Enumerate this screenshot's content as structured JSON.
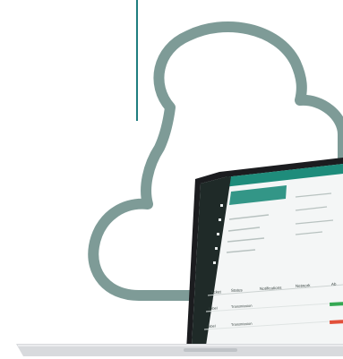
{
  "colors": {
    "background": "#ffffff",
    "cloud_outline": "#7e9b97",
    "accent_line": "#1f7d7f",
    "laptop_bezel": "#1b1c1f",
    "laptop_base": "#d8dadd",
    "app_header": "#1e8c7b",
    "app_sidebar": "#1f2a28",
    "status_green": "#34a853",
    "status_red": "#e2503a"
  },
  "laptop_app": {
    "toolbar": [
      "Ticket",
      "Status",
      "Notifications",
      "Network",
      "Ab"
    ],
    "rows": [
      {
        "col1": "Label",
        "col2": "Transmission",
        "col3": "",
        "col4": "",
        "status_color": "#34a853"
      },
      {
        "col1": "Label",
        "col2": "Transmission",
        "col3": "",
        "col4": "",
        "status_color": "#e2503a"
      }
    ]
  },
  "icons": [
    "cloud-outline-icon",
    "laptop-icon"
  ]
}
